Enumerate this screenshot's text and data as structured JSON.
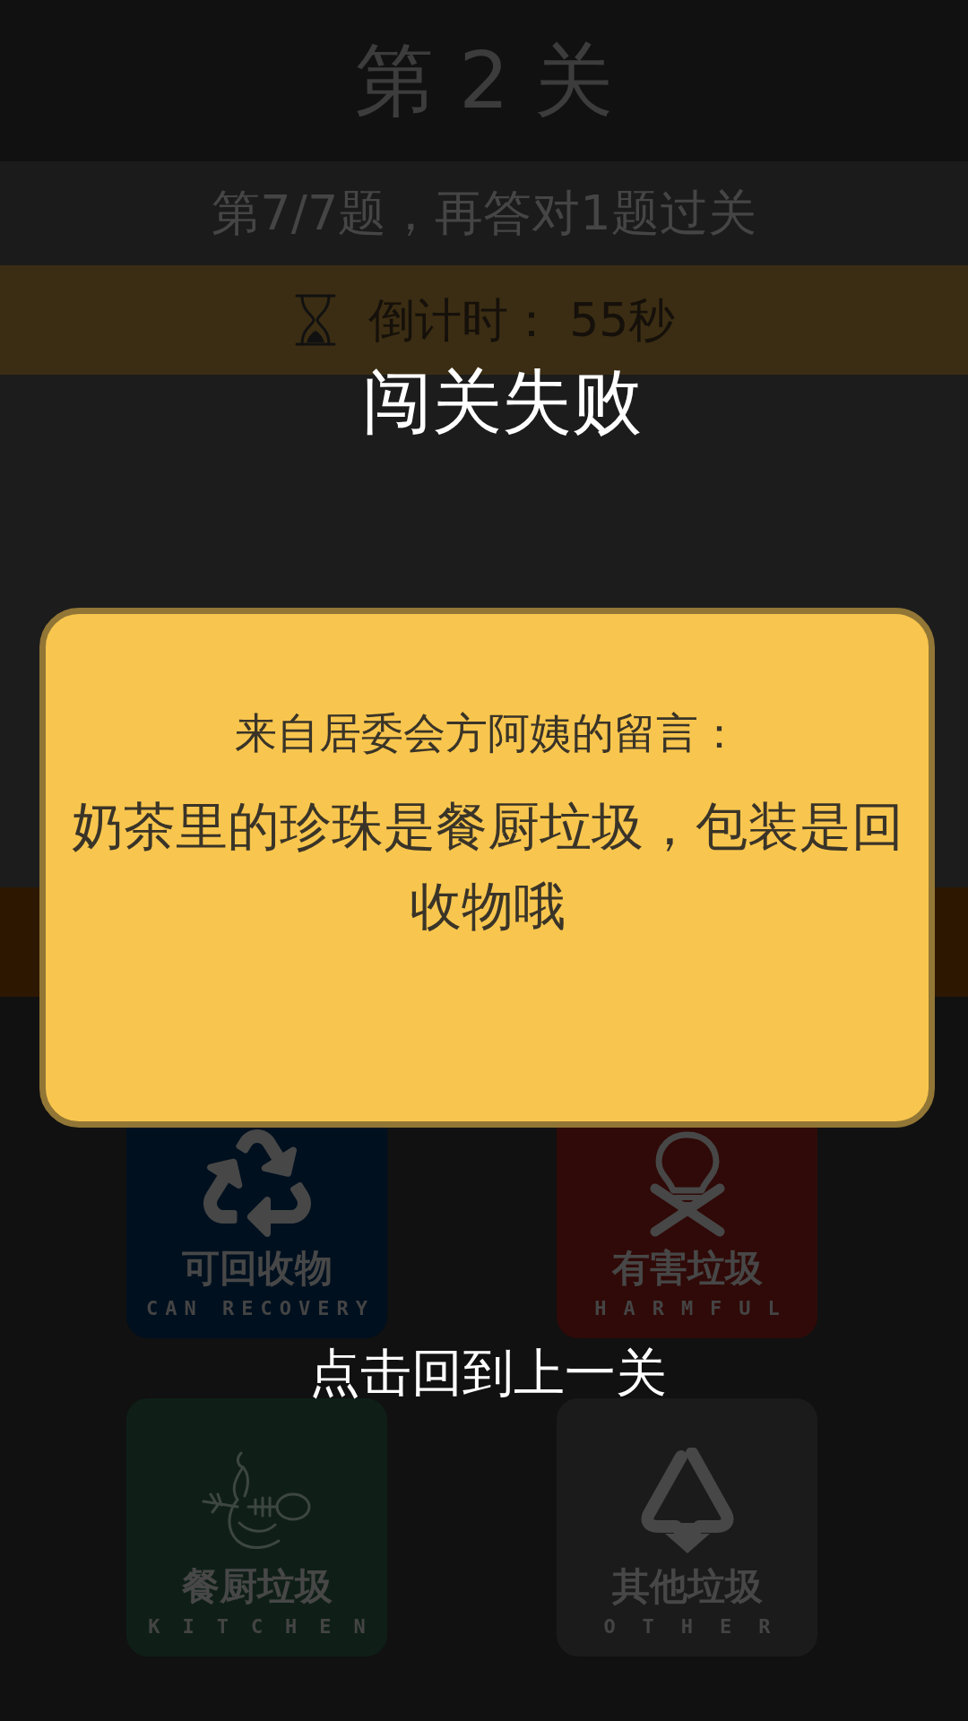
{
  "header": {
    "title": "第 2 关"
  },
  "progress": {
    "text": "第7/7题，再答对1题过关"
  },
  "timer": {
    "text": "倒计时： 55秒"
  },
  "result": {
    "title": "闯关失败",
    "action": "点击回到上一关"
  },
  "dialog": {
    "heading": "来自居委会方阿姨的留言：",
    "message": "奶茶里的珍珠是餐厨垃圾，包装是回收物哦"
  },
  "bins": [
    {
      "kind": "recyclable",
      "label": "可回收物",
      "label_en": "CAN RECOVERY",
      "color": "#00101f"
    },
    {
      "kind": "harmful",
      "label": "有害垃圾",
      "label_en": "HARMFUL",
      "color": "#300a08"
    },
    {
      "kind": "kitchen",
      "label": "餐厨垃圾",
      "label_en": "KITCHEN",
      "color": "#0f1f18"
    },
    {
      "kind": "other",
      "label": "其他垃圾",
      "label_en": "OTHER",
      "color": "#1b1b1b"
    }
  ]
}
